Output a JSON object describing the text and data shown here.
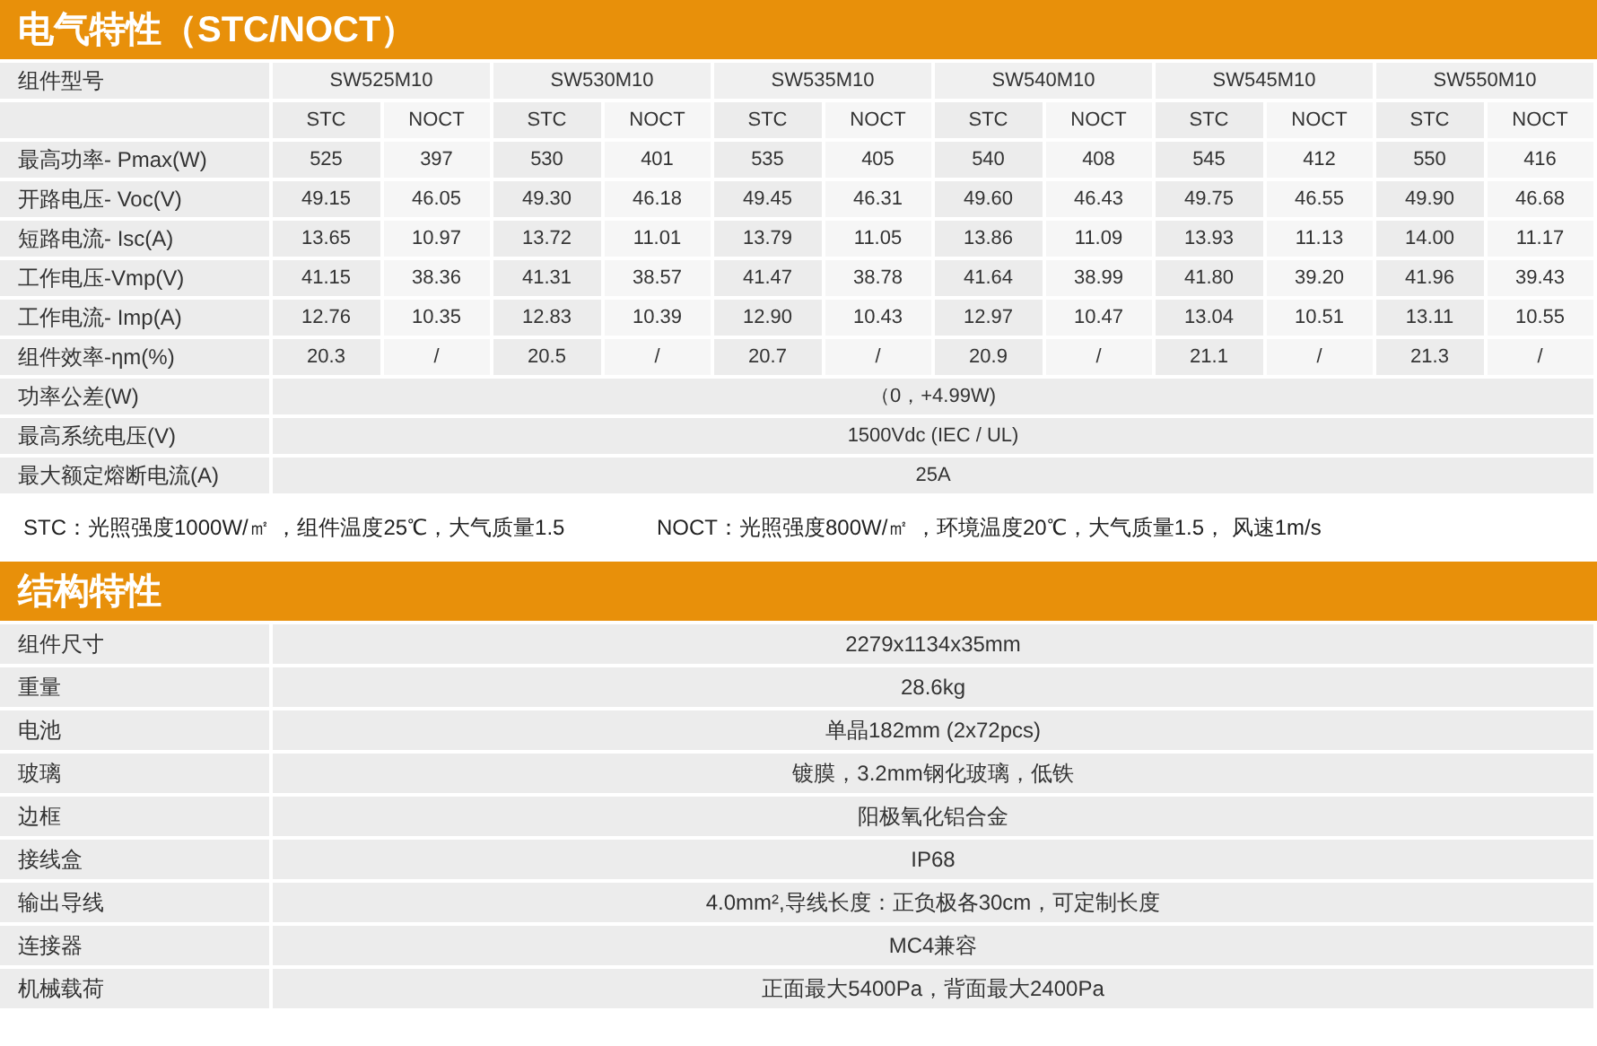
{
  "electrical": {
    "title": "电气特性（STC/NOCT）",
    "model_label": "组件型号",
    "models": [
      {
        "name": "SW525M10",
        "sub_headers": [
          "STC",
          "NOCT"
        ]
      },
      {
        "name": "SW530M10",
        "sub_headers": [
          "STC",
          "NOCT"
        ]
      },
      {
        "name": "SW535M10",
        "sub_headers": [
          "STC",
          "NOCT"
        ]
      },
      {
        "name": "SW540M10",
        "sub_headers": [
          "STC",
          "NOCT"
        ]
      },
      {
        "name": "SW545M10",
        "sub_headers": [
          "STC",
          "NOCT"
        ]
      },
      {
        "name": "SW550M10",
        "sub_headers": [
          "STC",
          "NOCT"
        ]
      }
    ],
    "rows": [
      {
        "label": "最高功率- Pmax(W)",
        "values": [
          "525",
          "397",
          "530",
          "401",
          "535",
          "405",
          "540",
          "408",
          "545",
          "412",
          "550",
          "416"
        ]
      },
      {
        "label": "开路电压- Voc(V)",
        "values": [
          "49.15",
          "46.05",
          "49.30",
          "46.18",
          "49.45",
          "46.31",
          "49.60",
          "46.43",
          "49.75",
          "46.55",
          "49.90",
          "46.68"
        ]
      },
      {
        "label": "短路电流- Isc(A)",
        "values": [
          "13.65",
          "10.97",
          "13.72",
          "11.01",
          "13.79",
          "11.05",
          "13.86",
          "11.09",
          "13.93",
          "11.13",
          "14.00",
          "11.17"
        ]
      },
      {
        "label": "工作电压-Vmp(V)",
        "values": [
          "41.15",
          "38.36",
          "41.31",
          "38.57",
          "41.47",
          "38.78",
          "41.64",
          "38.99",
          "41.80",
          "39.20",
          "41.96",
          "39.43"
        ]
      },
      {
        "label": "工作电流- Imp(A)",
        "values": [
          "12.76",
          "10.35",
          "12.83",
          "10.39",
          "12.90",
          "10.43",
          "12.97",
          "10.47",
          "13.04",
          "10.51",
          "13.11",
          "10.55"
        ]
      },
      {
        "label": "组件效率-ηm(%)",
        "values": [
          "20.3",
          "/",
          "20.5",
          "/",
          "20.7",
          "/",
          "20.9",
          "/",
          "21.1",
          "/",
          "21.3",
          "/"
        ]
      }
    ],
    "merged_rows": [
      {
        "label": "功率公差(W)",
        "value": "（0，+4.99W)"
      },
      {
        "label": "最高系统电压(V)",
        "value": "1500Vdc (IEC / UL)"
      },
      {
        "label": "最大额定熔断电流(A)",
        "value": "25A"
      }
    ]
  },
  "notes": [
    "STC：光照强度1000W/㎡ ，组件温度25℃，大气质量1.5",
    "NOCT：光照强度800W/㎡ ，环境温度20℃，大气质量1.5， 风速1m/s"
  ],
  "structural": {
    "title": "结构特性",
    "rows": [
      {
        "label": "组件尺寸",
        "value": "2279x1134x35mm"
      },
      {
        "label": "重量",
        "value": "28.6kg"
      },
      {
        "label": "电池",
        "value": "单晶182mm (2x72pcs)"
      },
      {
        "label": "玻璃",
        "value": "镀膜，3.2mm钢化玻璃，低铁"
      },
      {
        "label": "边框",
        "value": "阳极氧化铝合金"
      },
      {
        "label": "接线盒",
        "value": "IP68"
      },
      {
        "label": "输出导线",
        "value": "4.0mm²,导线长度：正负极各30cm，可定制长度"
      },
      {
        "label": "连接器",
        "value": "MC4兼容"
      },
      {
        "label": "机械载荷",
        "value": "正面最大5400Pa，背面最大2400Pa"
      }
    ]
  }
}
